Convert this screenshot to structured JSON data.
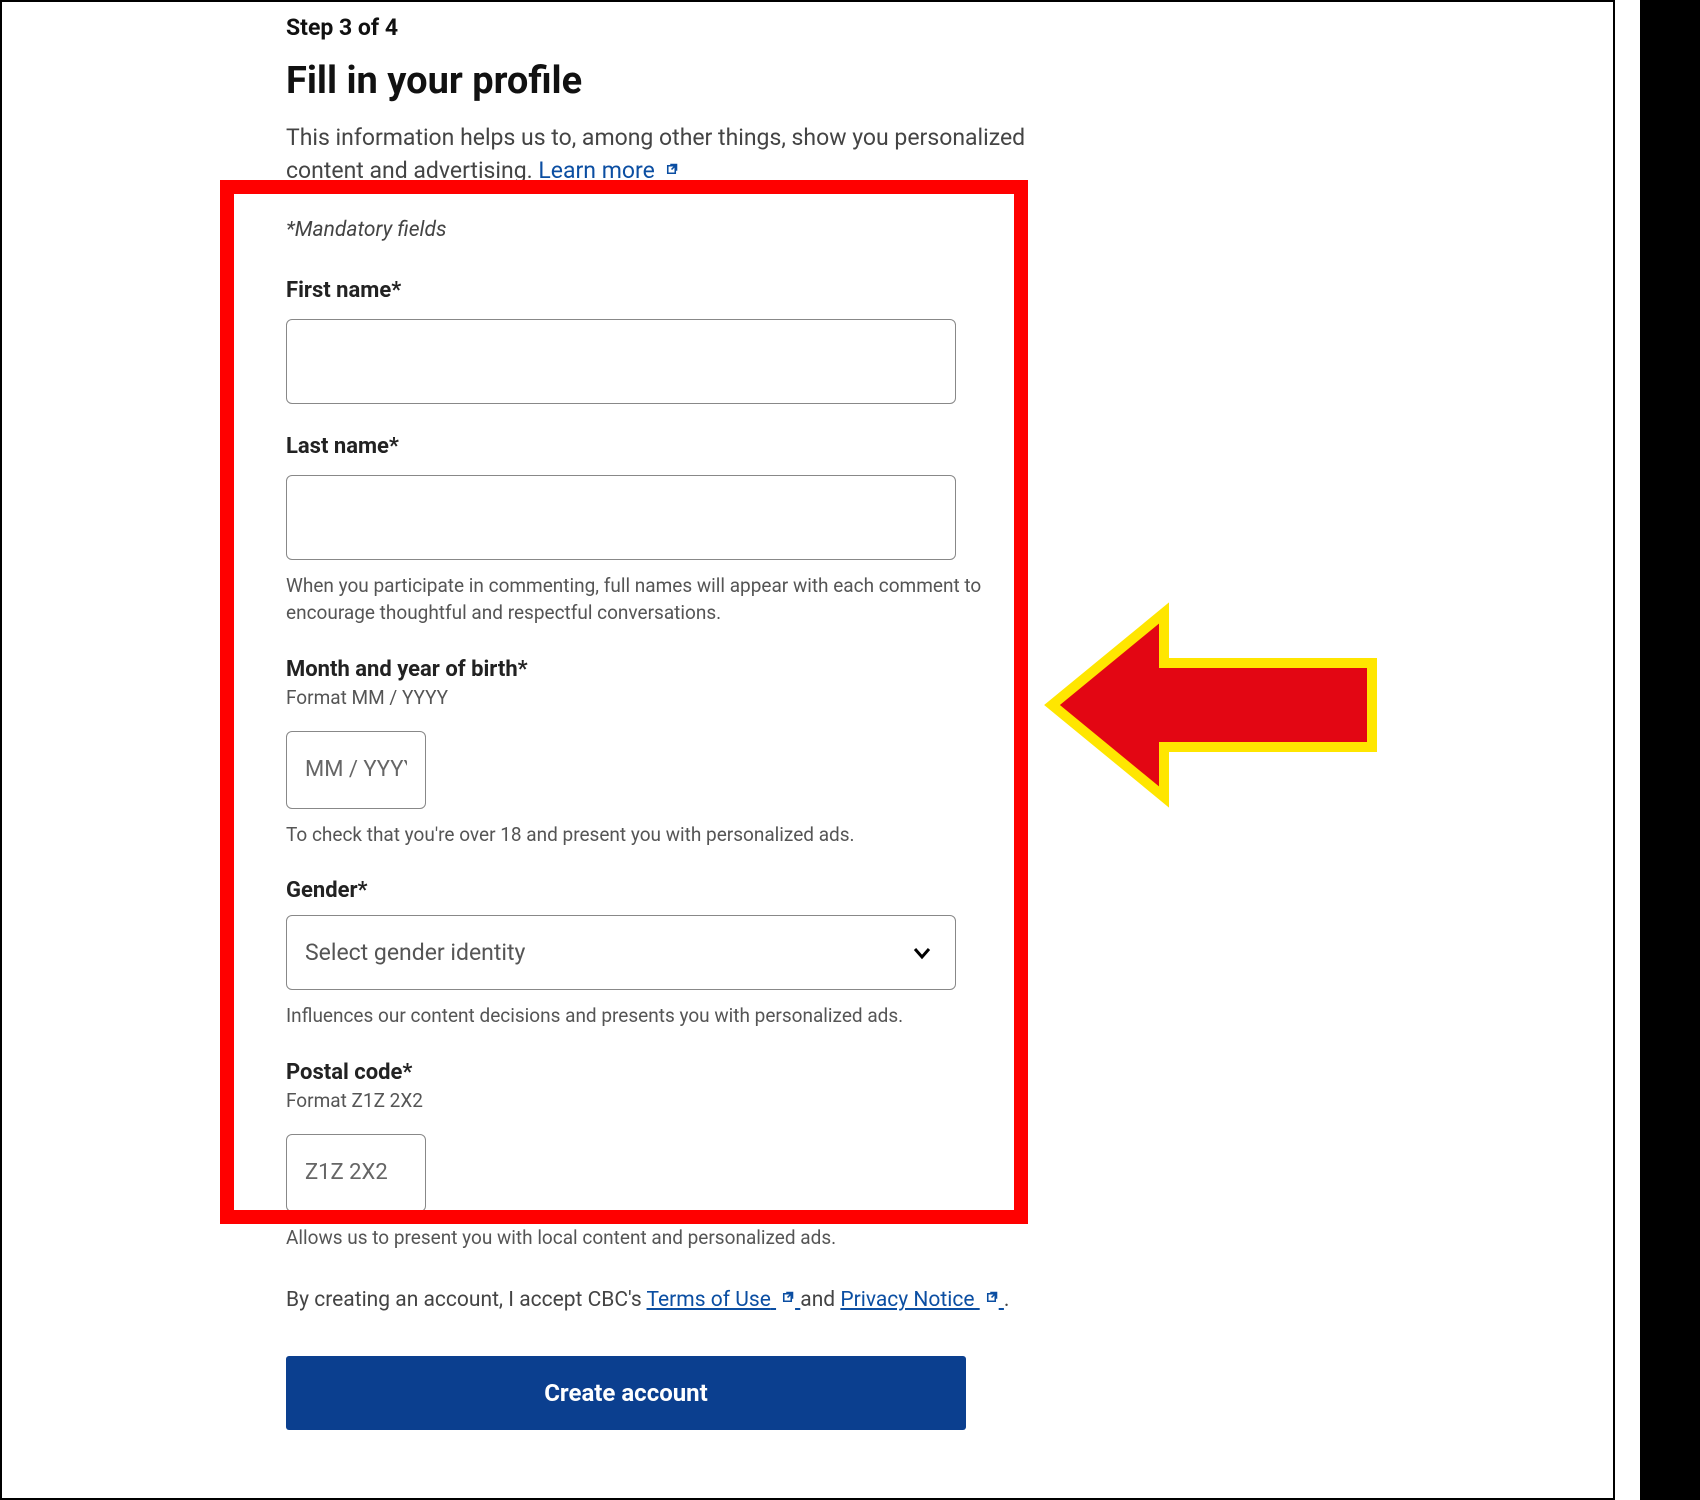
{
  "step_label": "Step 3 of 4",
  "page_title": "Fill in your profile",
  "intro_line1": "This information helps us to, among other things, show you personalized content and advertising. ",
  "learn_more": "Learn more",
  "mandatory_note": "*Mandatory fields",
  "fields": {
    "first_name": {
      "label": "First name*",
      "value": ""
    },
    "last_name": {
      "label": "Last name*",
      "value": "",
      "help": "When you participate in commenting, full names will appear with each comment to encourage thoughtful and respectful conversations."
    },
    "birth": {
      "label": "Month and year of birth*",
      "format": "Format MM / YYYY",
      "placeholder": "MM / YYYY",
      "value": "",
      "help": "To check that you're over 18 and present you with personalized ads."
    },
    "gender": {
      "label": "Gender*",
      "placeholder": "Select gender identity",
      "help": "Influences our content decisions and presents you with personalized ads."
    },
    "postal": {
      "label": "Postal code*",
      "format": "Format Z1Z 2X2",
      "placeholder": "Z1Z 2X2",
      "value": "",
      "help": "Allows us to present you with local content and personalized ads."
    }
  },
  "terms": {
    "prefix": "By creating an account, I accept CBC's ",
    "terms_link": "Terms of Use",
    "mid": " and ",
    "privacy_link": "Privacy Notice",
    "suffix": "."
  },
  "create_button": "Create account",
  "colors": {
    "link": "#0b4ea2",
    "btn_bg": "#0b3f8f",
    "highlight": "#f00",
    "arrow_fill": "#e30613",
    "arrow_stroke": "#ffe600"
  }
}
